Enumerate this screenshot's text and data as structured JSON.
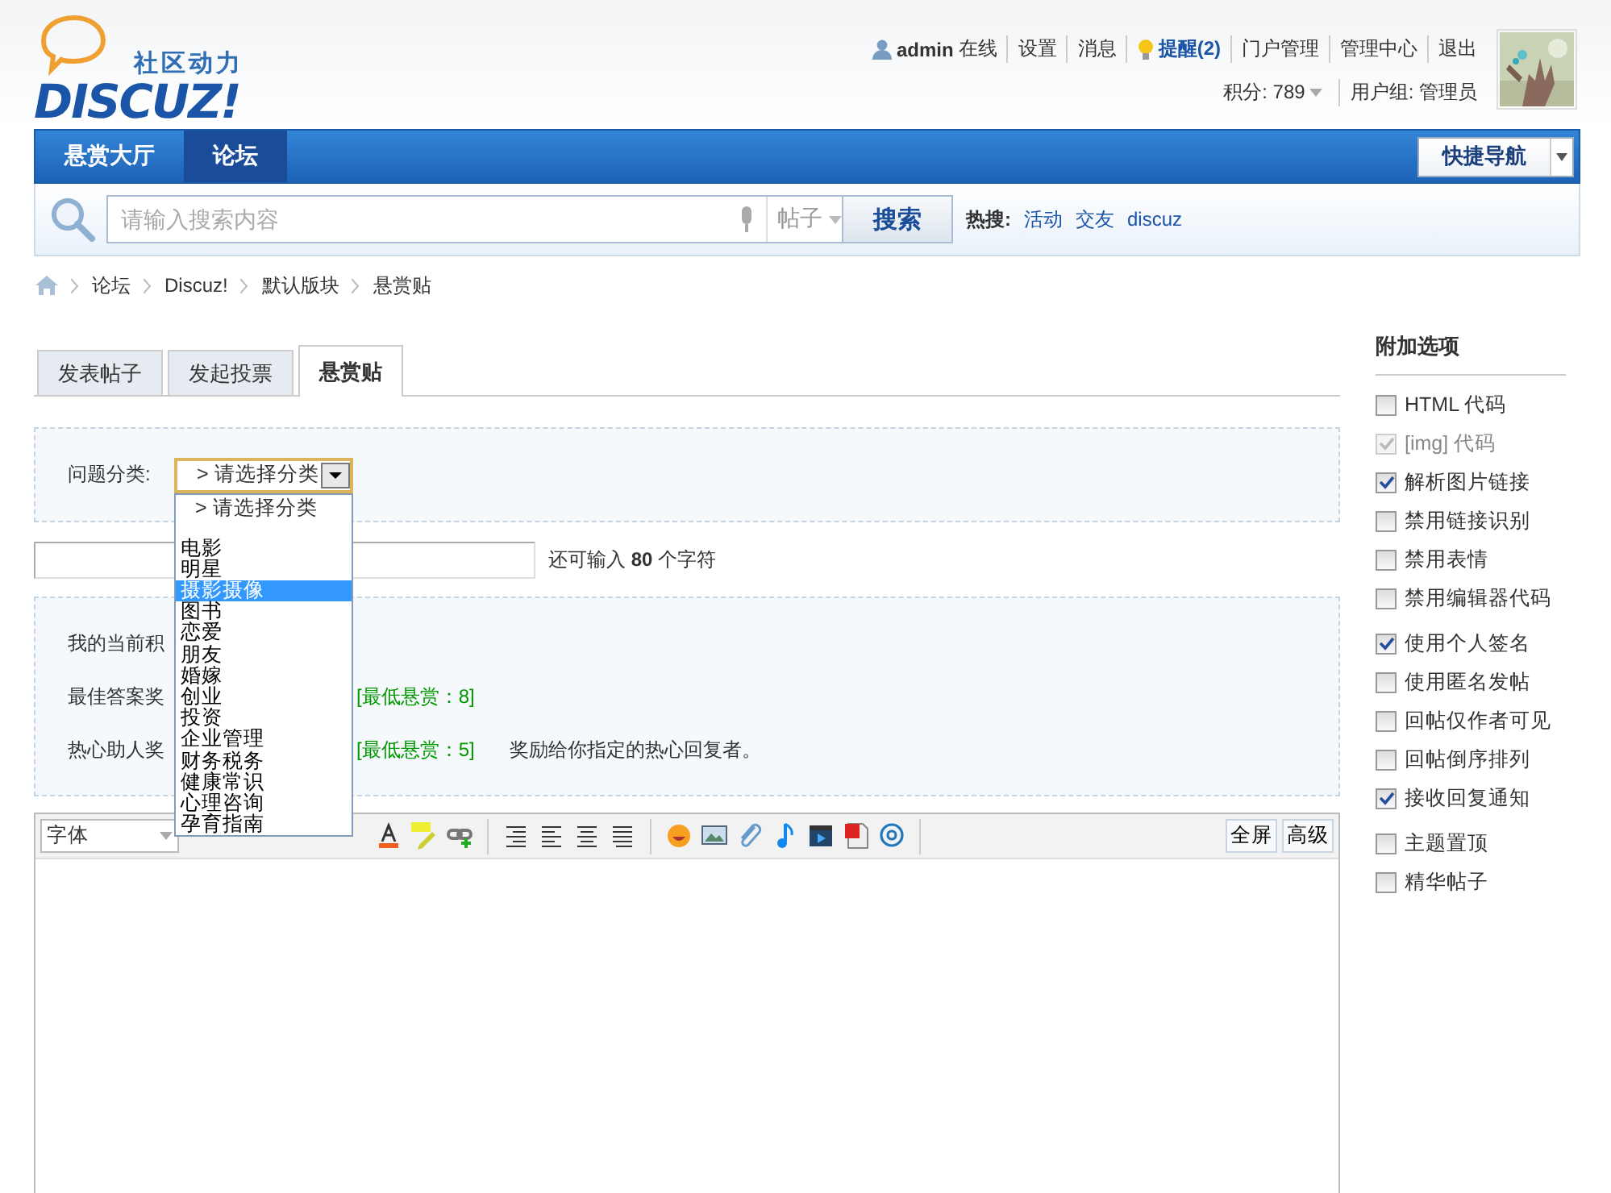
{
  "header": {
    "logo": {
      "tagline": "社区动力",
      "wordmark": "DISCUZ!"
    },
    "user": {
      "name": "admin",
      "status": "在线"
    },
    "links": [
      {
        "label": "设置",
        "kind": "plain"
      },
      {
        "label": "消息",
        "kind": "plain"
      },
      {
        "label": "提醒(2)",
        "kind": "alert"
      },
      {
        "label": "门户管理",
        "kind": "plain"
      },
      {
        "label": "管理中心",
        "kind": "plain"
      },
      {
        "label": "退出",
        "kind": "plain"
      }
    ],
    "credits": "积分: 789",
    "user_group": "用户组: 管理员"
  },
  "nav": {
    "tabs": [
      {
        "label": "悬赏大厅",
        "selected": false
      },
      {
        "label": "论坛",
        "selected": true
      }
    ],
    "quick_nav": "快捷导航"
  },
  "search": {
    "placeholder": "请输入搜索内容",
    "scope": "帖子",
    "button": "搜索",
    "hot_label": "热搜:",
    "hot": [
      "活动",
      "交友",
      "discuz"
    ]
  },
  "breadcrumb": [
    "论坛",
    "Discuz!",
    "默认版块",
    "悬赏贴"
  ],
  "post_tabs": [
    {
      "label": "发表帖子",
      "selected": false
    },
    {
      "label": "发起投票",
      "selected": false
    },
    {
      "label": "悬赏贴",
      "selected": true
    }
  ],
  "category": {
    "label": "问题分类:",
    "value": "> 请选择分类",
    "expanded": true,
    "prompt_option": "> 请选择分类",
    "options": [
      {
        "label": "电影",
        "selected": false
      },
      {
        "label": "明星",
        "selected": false
      },
      {
        "label": "摄影摄像",
        "selected": true
      },
      {
        "label": "图书",
        "selected": false
      },
      {
        "label": "恋爱",
        "selected": false
      },
      {
        "label": "朋友",
        "selected": false
      },
      {
        "label": "婚嫁",
        "selected": false
      },
      {
        "label": "创业",
        "selected": false
      },
      {
        "label": "投资",
        "selected": false
      },
      {
        "label": "企业管理",
        "selected": false
      },
      {
        "label": "财务税务",
        "selected": false
      },
      {
        "label": "健康常识",
        "selected": false
      },
      {
        "label": "心理咨询",
        "selected": false
      },
      {
        "label": "孕育指南",
        "selected": false
      }
    ]
  },
  "title_counter": "还可输入 **80** 个字符",
  "reward": [
    {
      "label": "我的当前积"
    },
    {
      "label": "最佳答案奖",
      "note": "[最低悬赏：8]"
    },
    {
      "label": "热心助人奖",
      "note": "[最低悬赏：5]",
      "hint": "奖励给你指定的热心回复者。"
    }
  ],
  "editor": {
    "font": "字体",
    "buttons": [
      "全屏",
      "高级"
    ]
  },
  "sidebar": {
    "title": "附加选项",
    "groups": [
      [
        {
          "label": "HTML 代码",
          "checked": false,
          "disabled": false
        },
        {
          "label": "[img] 代码",
          "checked": true,
          "disabled": true
        },
        {
          "label": "解析图片链接",
          "checked": true,
          "disabled": false
        },
        {
          "label": "禁用链接识别",
          "checked": false,
          "disabled": false
        },
        {
          "label": "禁用表情",
          "checked": false,
          "disabled": false
        },
        {
          "label": "禁用编辑器代码",
          "checked": false,
          "disabled": false
        }
      ],
      [
        {
          "label": "使用个人签名",
          "checked": true,
          "disabled": false
        },
        {
          "label": "使用匿名发帖",
          "checked": false,
          "disabled": false
        },
        {
          "label": "回帖仅作者可见",
          "checked": false,
          "disabled": false
        },
        {
          "label": "回帖倒序排列",
          "checked": false,
          "disabled": false
        },
        {
          "label": "接收回复通知",
          "checked": true,
          "disabled": false
        }
      ],
      [
        {
          "label": "主题置顶",
          "checked": false,
          "disabled": false
        },
        {
          "label": "精华帖子",
          "checked": false,
          "disabled": false
        }
      ]
    ]
  }
}
